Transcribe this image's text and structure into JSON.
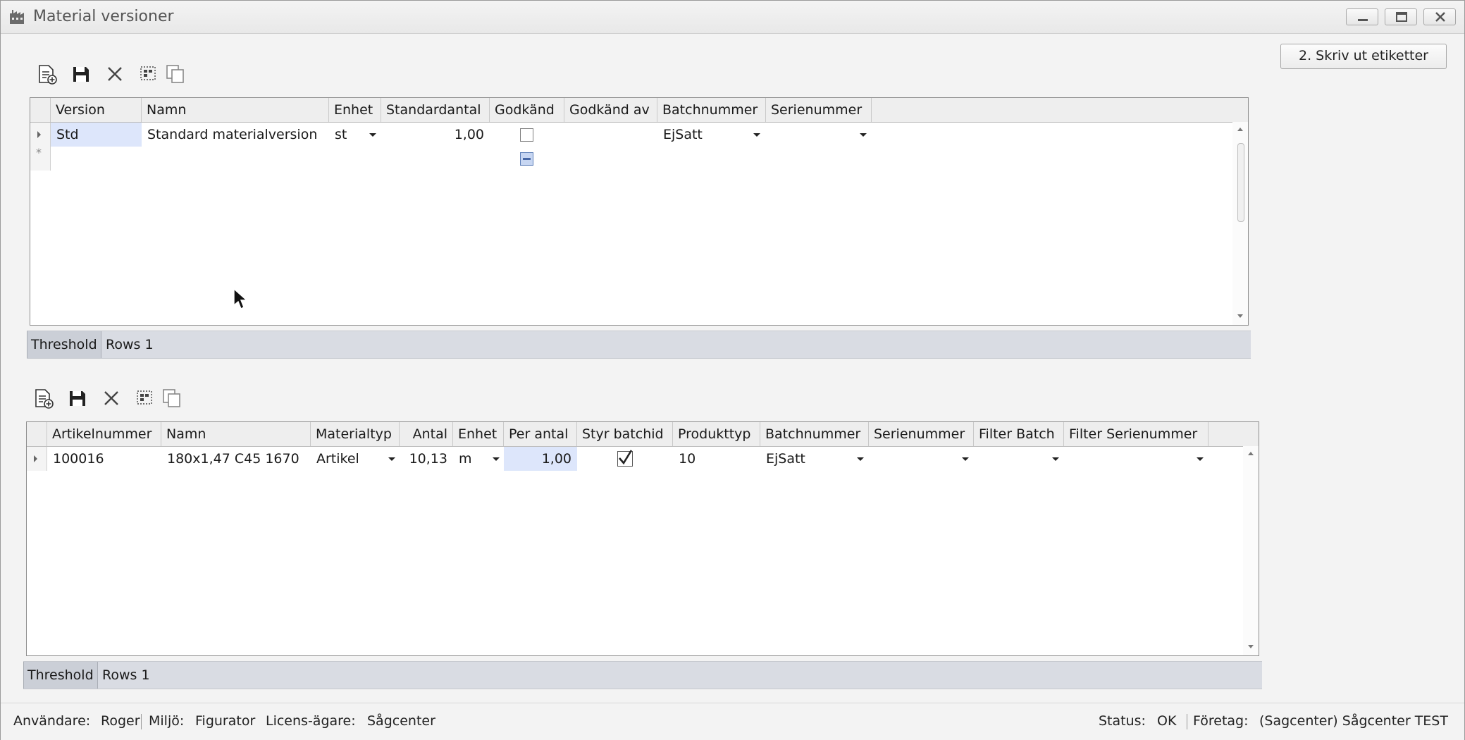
{
  "window": {
    "title": "Material versioner"
  },
  "actions": {
    "print_label": "2. Skriv ut etiketter"
  },
  "toolbar_icons": [
    "new-document-icon",
    "save-icon",
    "delete-icon",
    "select-icon",
    "copy-icon"
  ],
  "versions": {
    "columns": [
      "Version",
      "Namn",
      "Enhet",
      "Standardantal",
      "Godkänd",
      "Godkänd av",
      "Batchnummer",
      "Serienummer"
    ],
    "rows": [
      {
        "version": "Std",
        "namn": "Standard materialversion",
        "enhet": "st",
        "standardantal": "1,00",
        "godkand": false,
        "godkand_av": "",
        "batchnummer": "EjSatt",
        "serienummer": ""
      }
    ],
    "new_row_marker": "*",
    "status": {
      "threshold": "Threshold",
      "rows": "Rows 1"
    }
  },
  "materials": {
    "columns": [
      "Artikelnummer",
      "Namn",
      "Materialtyp",
      "Antal",
      "Enhet",
      "Per antal",
      "Styr batchid",
      "Produkttyp",
      "Batchnummer",
      "Serienummer",
      "Filter Batch",
      "Filter Serienummer"
    ],
    "rows": [
      {
        "artikelnummer": "100016",
        "namn": "180x1,47 C45 1670",
        "materialtyp": "Artikel",
        "antal": "10,13",
        "enhet": "m",
        "per_antal": "1,00",
        "styr_batchid": true,
        "produkttyp": "10",
        "batchnummer": "EjSatt",
        "serienummer": "",
        "filter_batch": "",
        "filter_serienummer": ""
      }
    ],
    "status": {
      "threshold": "Threshold",
      "rows": "Rows 1"
    }
  },
  "statusbar": {
    "user_label": "Användare:",
    "user": "Roger",
    "env_label": "Miljö:",
    "env": "Figurator",
    "license_label": "Licens-ägare:",
    "license": "Sågcenter",
    "status_label": "Status:",
    "status": "OK",
    "company_label": "Företag:",
    "company": "(Sagcenter) Sågcenter TEST"
  },
  "colors": {
    "selection": "#dde6fb",
    "statusbar_bg": "#d9dce3"
  }
}
